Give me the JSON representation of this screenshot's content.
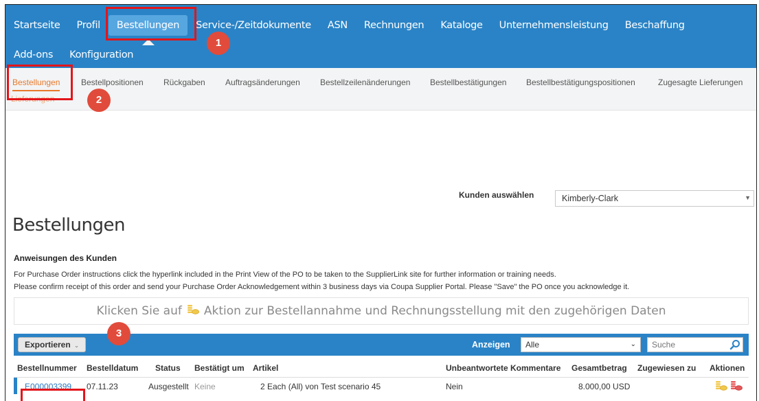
{
  "nav": {
    "row1": [
      "Startseite",
      "Profil",
      "Bestellungen",
      "Service-/Zeitdokumente",
      "ASN",
      "Rechnungen",
      "Kataloge",
      "Unternehmensleistung",
      "Beschaffung"
    ],
    "row2": [
      "Add-ons",
      "Konfiguration"
    ],
    "active": "Bestellungen"
  },
  "subnav": {
    "items": [
      "Bestellungen",
      "Bestellpositionen",
      "Rückgaben",
      "Auftragsänderungen",
      "Bestellzeilenänderungen",
      "Bestellbestätigungen",
      "Bestellbestätigungspositionen",
      "Zugesagte Lieferungen"
    ],
    "wrapped": "Lieferungen",
    "active": "Bestellungen"
  },
  "customer": {
    "label": "Kunden auswählen",
    "selected": "Kimberly-Clark"
  },
  "page_title": "Bestellungen",
  "instructions": {
    "heading": "Anweisungen des Kunden",
    "line1": "For Purchase Order instructions click the hyperlink included in the Print View of the PO to be taken to the SupplierLink site for further information or training needs.",
    "line2": "Please confirm receipt of this order and send your Purchase Order Acknowledgement within 3 business days via Coupa Supplier Portal. Please \"Save\" the PO once you acknowledge it."
  },
  "banner": {
    "before": "Klicken Sie auf",
    "after": "Aktion zur Bestellannahme und Rechnungsstellung mit den zugehörigen Daten"
  },
  "toolbar": {
    "export_label": "Exportieren",
    "show_label": "Anzeigen",
    "show_value": "Alle",
    "search_placeholder": "Suche"
  },
  "table": {
    "columns": [
      "Bestellnummer",
      "Bestelldatum",
      "Status",
      "Bestätigt um",
      "Artikel",
      "Unbeantwortete Kommentare",
      "Gesamtbetrag",
      "Zugewiesen zu",
      "Aktionen"
    ],
    "rows": [
      {
        "po_number": "E000003399",
        "date": "07.11.23",
        "status": "Ausgestellt",
        "confirmed": "Keine",
        "item": "2 Each (All) von Test scenario 45",
        "comments": "Nein",
        "total": "8.000,00 USD",
        "assigned": ""
      }
    ]
  },
  "annotations": {
    "badges": [
      "1",
      "2",
      "3"
    ]
  },
  "colors": {
    "nav_bg": "#2a83c6",
    "nav_active": "#56a6e0",
    "sub_active": "#e8792b",
    "highlight": "#e3151a",
    "badge": "#e14b3b"
  },
  "icons": {
    "banner_icon": "coins-icon",
    "action_icons": [
      "invoice-coins-icon",
      "flip-coins-icon"
    ]
  }
}
